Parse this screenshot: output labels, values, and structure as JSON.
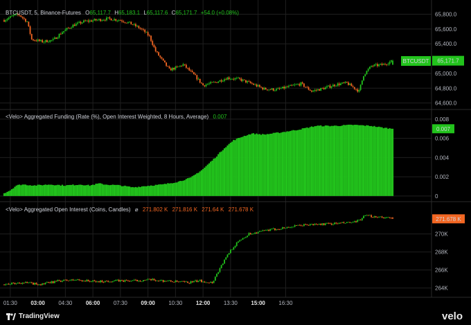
{
  "colors": {
    "up": "#22c31c",
    "down": "#f26622",
    "bg": "#000000",
    "grid": "#1f1f1f",
    "text": "#d1d4dc"
  },
  "pane1": {
    "symbol": "BTCUSDT, 5, Binance-Futures",
    "o_label": "O",
    "o_val": "65,117.7",
    "h_label": "H",
    "h_val": "65,183.1",
    "l_label": "L",
    "l_val": "65,117.6",
    "c_label": "C",
    "c_val": "65,171.7",
    "change": "+54.0 (+0.08%)",
    "price_tag_name": "BTCUSDT",
    "price_tag_value": "65,171.7",
    "yticks": [
      "65,800.0",
      "65,600.0",
      "65,400.0",
      "65,000.0",
      "64,800.0",
      "64,600.0"
    ]
  },
  "pane2": {
    "title": "<Velo> Aggregated Funding (Rate (%), Open Interest Weighted, 8 Hours, Average)",
    "value": "0.007",
    "tag_value": "0.007",
    "yticks": [
      "0.008",
      "0.006",
      "0.004",
      "0.002",
      "0"
    ]
  },
  "pane3": {
    "title": "<Velo> Aggregated Open Interest (Coins, Candles)",
    "symbol_glyph": "⌀",
    "o": "271.802 K",
    "h": "271.816 K",
    "l": "271.64 K",
    "c": "271.678 K",
    "tag_value": "271.678 K",
    "yticks": [
      "270K",
      "268K",
      "266K",
      "264K"
    ]
  },
  "xaxis": {
    "ticks": [
      {
        "label": "01:30",
        "bold": false
      },
      {
        "label": "03:00",
        "bold": true
      },
      {
        "label": "04:30",
        "bold": false
      },
      {
        "label": "06:00",
        "bold": true
      },
      {
        "label": "07:30",
        "bold": false
      },
      {
        "label": "09:00",
        "bold": true
      },
      {
        "label": "10:30",
        "bold": false
      },
      {
        "label": "12:00",
        "bold": true
      },
      {
        "label": "13:30",
        "bold": false
      },
      {
        "label": "15:00",
        "bold": true
      },
      {
        "label": "16:30",
        "bold": false
      }
    ]
  },
  "footer": {
    "brand": "TradingView",
    "velo": "velo"
  },
  "chart_data": [
    {
      "type": "candlestick",
      "title": "BTCUSDT, 5, Binance-Futures",
      "x": [
        "01:30",
        "03:00",
        "04:30",
        "06:00",
        "07:30",
        "09:00",
        "10:30",
        "12:00",
        "13:30",
        "15:00",
        "16:30"
      ],
      "ylim": [
        64550,
        65880
      ],
      "close_path": [
        [
          0,
          65720
        ],
        [
          6,
          65780
        ],
        [
          10,
          65790
        ],
        [
          15,
          65700
        ],
        [
          18,
          65460
        ],
        [
          25,
          65430
        ],
        [
          32,
          65450
        ],
        [
          38,
          65560
        ],
        [
          45,
          65650
        ],
        [
          52,
          65700
        ],
        [
          60,
          65720
        ],
        [
          68,
          65740
        ],
        [
          76,
          65720
        ],
        [
          82,
          65680
        ],
        [
          88,
          65620
        ],
        [
          92,
          65560
        ],
        [
          95,
          65500
        ],
        [
          99,
          65300
        ],
        [
          104,
          65160
        ],
        [
          108,
          65050
        ],
        [
          113,
          65080
        ],
        [
          117,
          65120
        ],
        [
          121,
          65040
        ],
        [
          125,
          64960
        ],
        [
          130,
          64840
        ],
        [
          138,
          64880
        ],
        [
          146,
          64940
        ],
        [
          154,
          64920
        ],
        [
          162,
          64860
        ],
        [
          170,
          64790
        ],
        [
          178,
          64780
        ],
        [
          186,
          64820
        ],
        [
          194,
          64860
        ],
        [
          201,
          64760
        ],
        [
          209,
          64800
        ],
        [
          217,
          64850
        ],
        [
          224,
          64870
        ],
        [
          232,
          64760
        ],
        [
          235,
          64980
        ],
        [
          240,
          65100
        ],
        [
          248,
          65120
        ],
        [
          254,
          65171.7
        ]
      ],
      "last": {
        "open": 65117.7,
        "high": 65183.1,
        "low": 65117.6,
        "close": 65171.7
      }
    },
    {
      "type": "bar",
      "title": "<Velo> Aggregated Funding (Rate (%), Open Interest Weighted, 8 Hours, Average)",
      "ylim": [
        -0.0003,
        0.0085
      ],
      "path": [
        [
          0,
          0.0003
        ],
        [
          4,
          0.0006
        ],
        [
          8,
          0.0011
        ],
        [
          12,
          0.0012
        ],
        [
          20,
          0.0011
        ],
        [
          30,
          0.0012
        ],
        [
          40,
          0.0011
        ],
        [
          50,
          0.0012
        ],
        [
          56,
          0.0011
        ],
        [
          62,
          0.0013
        ],
        [
          66,
          0.0012
        ],
        [
          76,
          0.0011
        ],
        [
          84,
          0.0009
        ],
        [
          96,
          0.0011
        ],
        [
          104,
          0.0012
        ],
        [
          114,
          0.0015
        ],
        [
          122,
          0.0019
        ],
        [
          130,
          0.0028
        ],
        [
          138,
          0.004
        ],
        [
          144,
          0.005
        ],
        [
          150,
          0.0058
        ],
        [
          156,
          0.0062
        ],
        [
          162,
          0.0065
        ],
        [
          170,
          0.0064
        ],
        [
          180,
          0.0066
        ],
        [
          192,
          0.0069
        ],
        [
          204,
          0.0073
        ],
        [
          216,
          0.0073
        ],
        [
          228,
          0.0074
        ],
        [
          240,
          0.0073
        ],
        [
          248,
          0.0071
        ],
        [
          254,
          0.007
        ]
      ],
      "last": 0.007
    },
    {
      "type": "candlestick",
      "title": "<Velo> Aggregated Open Interest (Coins, Candles)",
      "ylim": [
        263.2,
        273.2
      ],
      "path": [
        [
          0,
          264.4
        ],
        [
          12,
          264.6
        ],
        [
          24,
          264.4
        ],
        [
          36,
          264.8
        ],
        [
          48,
          264.9
        ],
        [
          60,
          264.7
        ],
        [
          72,
          264.8
        ],
        [
          84,
          264.8
        ],
        [
          96,
          264.9
        ],
        [
          104,
          264.8
        ],
        [
          112,
          264.7
        ],
        [
          120,
          264.6
        ],
        [
          128,
          264.8
        ],
        [
          136,
          264.6
        ],
        [
          142,
          266.5
        ],
        [
          148,
          268.2
        ],
        [
          154,
          269.3
        ],
        [
          160,
          270.0
        ],
        [
          172,
          270.4
        ],
        [
          184,
          270.7
        ],
        [
          196,
          271.0
        ],
        [
          210,
          271.1
        ],
        [
          222,
          271.2
        ],
        [
          230,
          271.3
        ],
        [
          236,
          272.0
        ],
        [
          246,
          271.9
        ],
        [
          254,
          271.678
        ]
      ],
      "last": {
        "open": 271.802,
        "high": 271.816,
        "low": 271.64,
        "close": 271.678
      }
    }
  ]
}
